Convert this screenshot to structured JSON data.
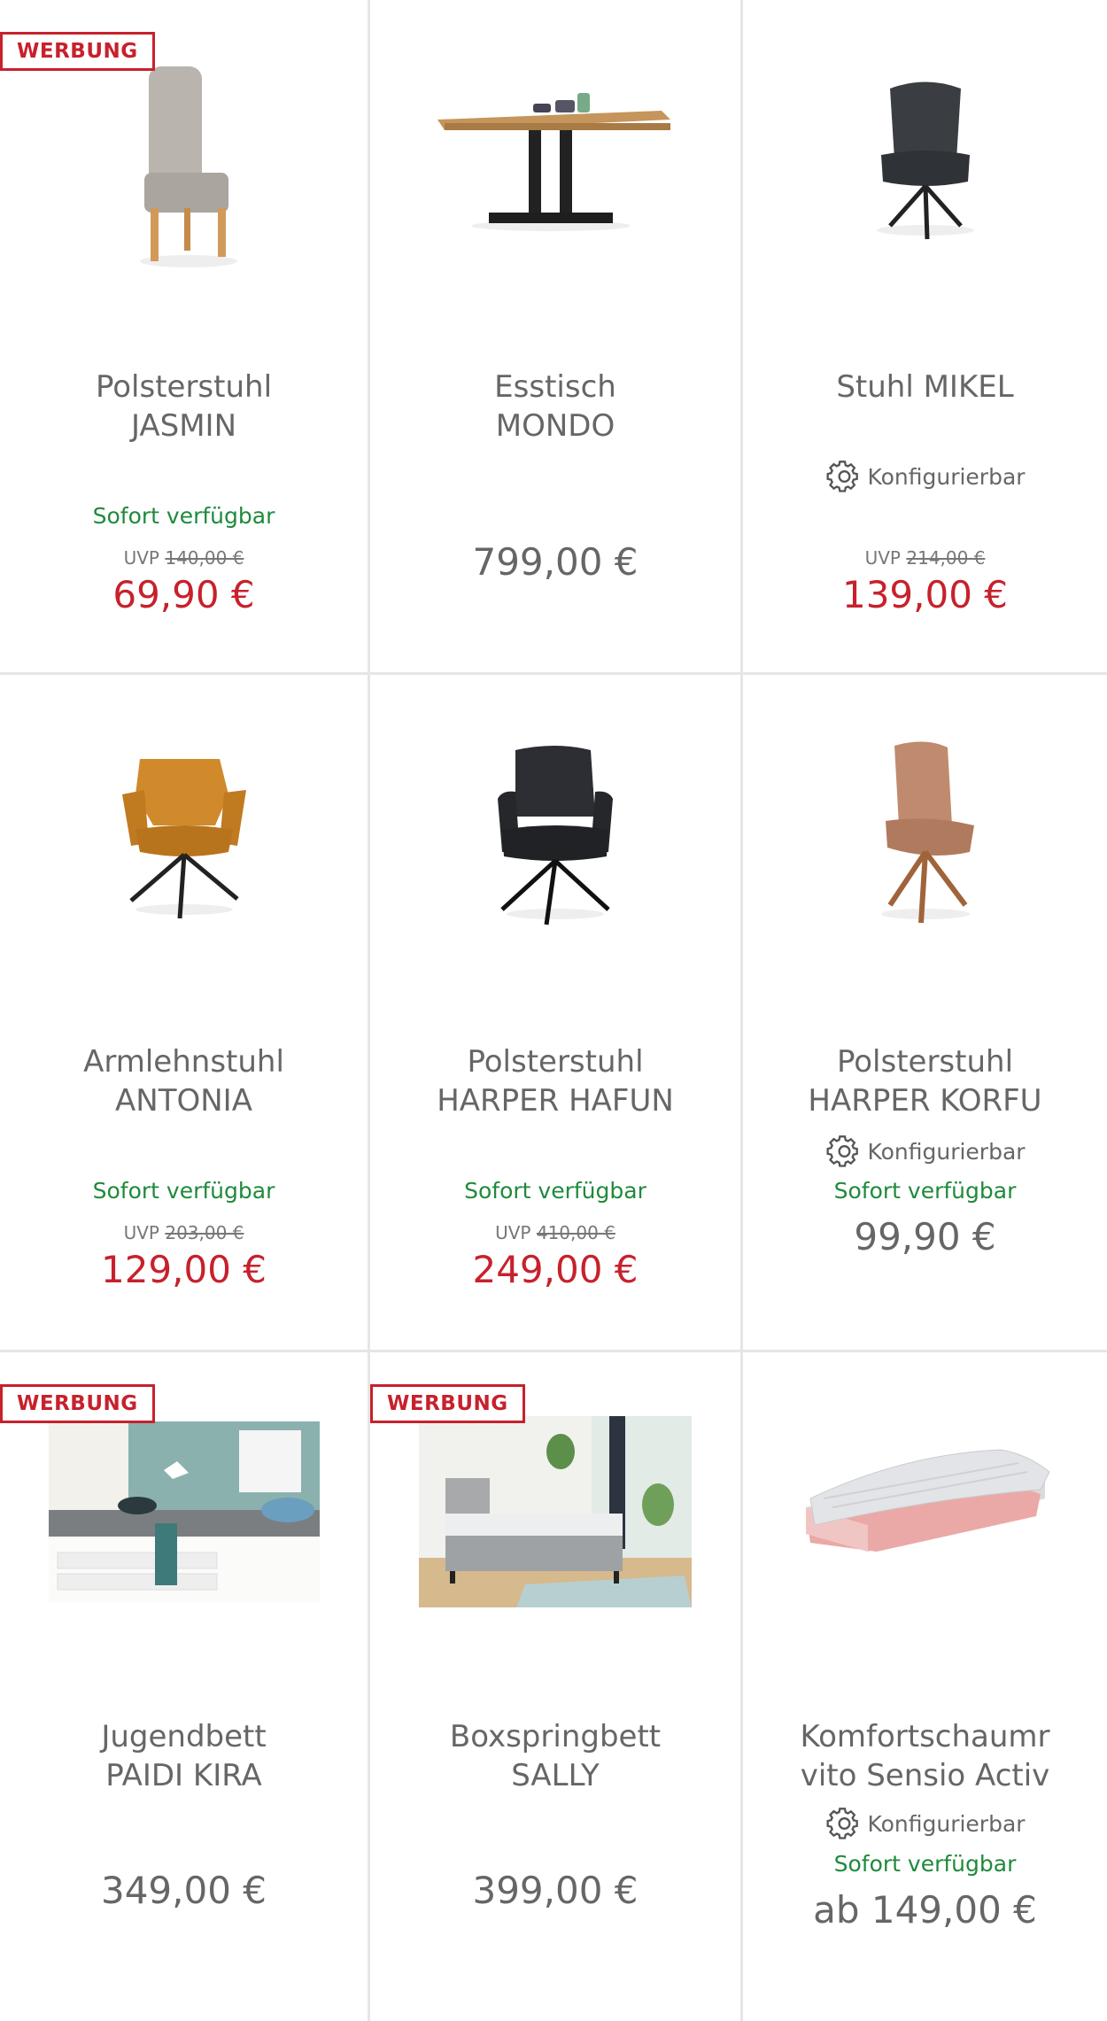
{
  "products": [
    {
      "badge": "WERBUNG",
      "title_line1": "Polsterstuhl",
      "title_line2": "JASMIN",
      "availability": "Sofort verfügbar",
      "uvp_label": "UVP",
      "uvp_price": "140,00 €",
      "price": "69,90 €"
    },
    {
      "title_line1": "Esstisch",
      "title_line2": "MONDO",
      "price": "799,00 €"
    },
    {
      "title_line1": "Stuhl MIKEL",
      "configurable": "Konfigurierbar",
      "uvp_label": "UVP",
      "uvp_price": "214,00 €",
      "price": "139,00 €"
    },
    {
      "title_line1": "Armlehnstuhl",
      "title_line2": "ANTONIA",
      "availability": "Sofort verfügbar",
      "uvp_label": "UVP",
      "uvp_price": "203,00 €",
      "price": "129,00 €"
    },
    {
      "title_line1": "Polsterstuhl",
      "title_line2": "HARPER HAFUN",
      "availability": "Sofort verfügbar",
      "uvp_label": "UVP",
      "uvp_price": "410,00 €",
      "price": "249,00 €"
    },
    {
      "title_line1": "Polsterstuhl",
      "title_line2": "HARPER KORFU",
      "configurable": "Konfigurierbar",
      "availability": "Sofort verfügbar",
      "price": "99,90 €"
    },
    {
      "badge": "WERBUNG",
      "title_line1": "Jugendbett",
      "title_line2": "PAIDI KIRA",
      "price": "349,00 €"
    },
    {
      "badge": "WERBUNG",
      "title_line1": "Boxspringbett",
      "title_line2": "SALLY",
      "price": "399,00 €"
    },
    {
      "title_line1": "Komfortschaumr",
      "title_line2": "vito Sensio Activ",
      "configurable": "Konfigurierbar",
      "availability": "Sofort verfügbar",
      "price": "ab 149,00 €"
    }
  ],
  "icons": {
    "configurable": "gear-icon"
  },
  "colors": {
    "sale_price": "#c7212c",
    "availability": "#1f8a3b",
    "badge": "#c7212c"
  }
}
